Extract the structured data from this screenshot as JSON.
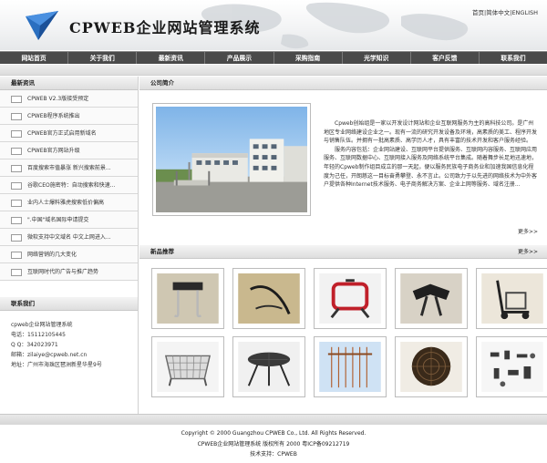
{
  "header": {
    "logo_text": "CPWEB企业网站管理系统",
    "top_links": [
      "首页",
      "简体中文",
      "ENGLISH"
    ],
    "top_sep": "|"
  },
  "nav": {
    "items": [
      "网站首页",
      "关于我们",
      "最新资讯",
      "产品展示",
      "采购指南",
      "光学知识",
      "客户反馈",
      "联系我们"
    ]
  },
  "sidebar": {
    "news_title": "最新资讯",
    "news": [
      "CPWEB V2.3版接受预定",
      "CPWEB程序系统推出",
      "CPWEB官方正式启用新域名",
      "CPWEB官方网站升级",
      "百度搜索市值暴涨 新兴搜索前景...",
      "谷歌CEO施密特：自动搜索和快速...",
      "业内人士爆料雅虎搜索低价偏高",
      "\".中国\"域名国际申请提交",
      "微软支持中文域名 中文上网进入...",
      "网络营销的几大变化",
      "互联网时代的广告与推广趋势"
    ],
    "contact_title": "联系我们",
    "contact": [
      "cpweb企业网站管理系统",
      "电话：15112105445",
      "Q  Q：342023971",
      "邮箱：zilaiye@cpweb.net.cn",
      "地址：广州市海珠区琶洲新星华星9号"
    ]
  },
  "main": {
    "about_title": "公司简介",
    "about_paragraphs": [
      "Cpweb创始组是一家以开发设计网站和企业互联网服务为主的高科技公司。是广州地区专业网络建设企业之一。现有一流的研究开发设备及环境，高素质的美工、程序开发与销售队伍。并拥有一批高素质、高学历人才，具有丰富的技术开发和客户服务经验。",
      "服务内容包括：企业网站建设、互联网平台提供服务、互联网内容服务、互联网应用服务、互联网数据中心、互联网接入服务及网络系统平台集成。随着舞步长足地迅速地，年轻的Cpweb制作组目成立的那一天起，便以服务民族电子商务业和加速我国信息化程度为己任，开朗慈这一目标奋勇攀登、永不言止。公司致力于以先进的网络技术为中外客户提供各种Internet技术服务、电子商务解决方案、企业上网等服务、域名注册..."
    ],
    "more": "更多>>",
    "products_title": "新品推荐",
    "products": [
      {
        "icon": "hook-rack-icon"
      },
      {
        "icon": "wire-hook-icon"
      },
      {
        "icon": "red-frame-icon"
      },
      {
        "icon": "black-clamp-icon"
      },
      {
        "icon": "hand-cart-icon"
      },
      {
        "icon": "wire-basket-icon"
      },
      {
        "icon": "round-table-icon"
      },
      {
        "icon": "blue-rack-icon"
      },
      {
        "icon": "fan-grill-icon"
      },
      {
        "icon": "steel-parts-icon"
      }
    ]
  },
  "footer": {
    "line1": "Copyright © 2000 Guangzhou CPWEB Co., Ltd.  All Rights Reserved.",
    "line2": "CPWEB企业网站管理系统 版权所有 2000   粤ICP备09212719",
    "line3": "技术支持：CPWEB"
  },
  "colors": {
    "nav_bg": "#4a4a4a",
    "accent_blue": "#2a6fc0"
  }
}
